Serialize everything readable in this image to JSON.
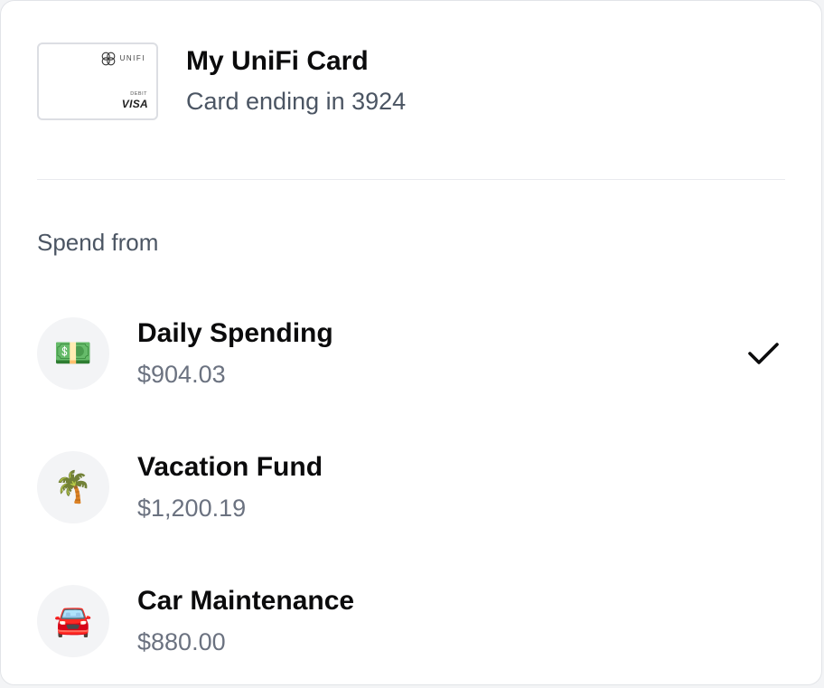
{
  "card": {
    "logo_text": "UNIFI",
    "debit_label": "DEBIT",
    "network": "VISA",
    "name": "My UniFi Card",
    "ending": "Card ending in 3924"
  },
  "spend_from": {
    "label": "Spend from",
    "accounts": [
      {
        "name": "Daily Spending",
        "balance": "$904.03",
        "icon": "money-icon",
        "emoji": "💵",
        "selected": true
      },
      {
        "name": "Vacation Fund",
        "balance": "$1,200.19",
        "icon": "palm-tree-icon",
        "emoji": "🌴",
        "selected": false
      },
      {
        "name": "Car Maintenance",
        "balance": "$880.00",
        "icon": "car-icon",
        "emoji": "🚘",
        "selected": false
      }
    ]
  }
}
